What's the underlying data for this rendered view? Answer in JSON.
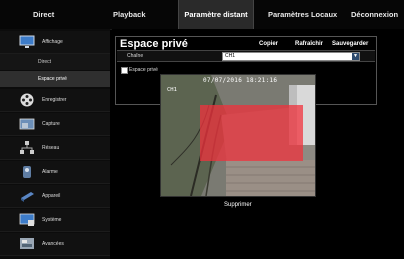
{
  "topnav": {
    "tabs": [
      {
        "label": "Direct"
      },
      {
        "label": "Playback"
      },
      {
        "label": "Paramètre distant"
      },
      {
        "label": "Paramètres Locaux"
      },
      {
        "label": "Déconnexion"
      }
    ]
  },
  "sidebar": {
    "items": [
      {
        "label": "Affichage"
      },
      {
        "label": "Enregistrer"
      },
      {
        "label": "Capture"
      },
      {
        "label": "Réseau"
      },
      {
        "label": "Alarme"
      },
      {
        "label": "Appareil"
      },
      {
        "label": "Système"
      },
      {
        "label": "Avancées"
      }
    ],
    "subitems": [
      {
        "label": "Direct"
      },
      {
        "label": "Espace privé"
      }
    ]
  },
  "panel": {
    "title": "Espace privé",
    "copy_label": "Copier",
    "refresh_label": "Rafraîchir",
    "save_label": "Sauvegarder",
    "channel_label": "Chaîne",
    "channel_value": "CH1",
    "privacy_checkbox_label": "Espace privé",
    "privacy_checked": false
  },
  "video": {
    "timestamp": "07/07/2016 18:21:16",
    "channel_osd": "CH1"
  },
  "delete_label": "Supprimer",
  "colors": {
    "privacy_mask": "#f0323c",
    "select_arrow": "#2e4b6e"
  }
}
